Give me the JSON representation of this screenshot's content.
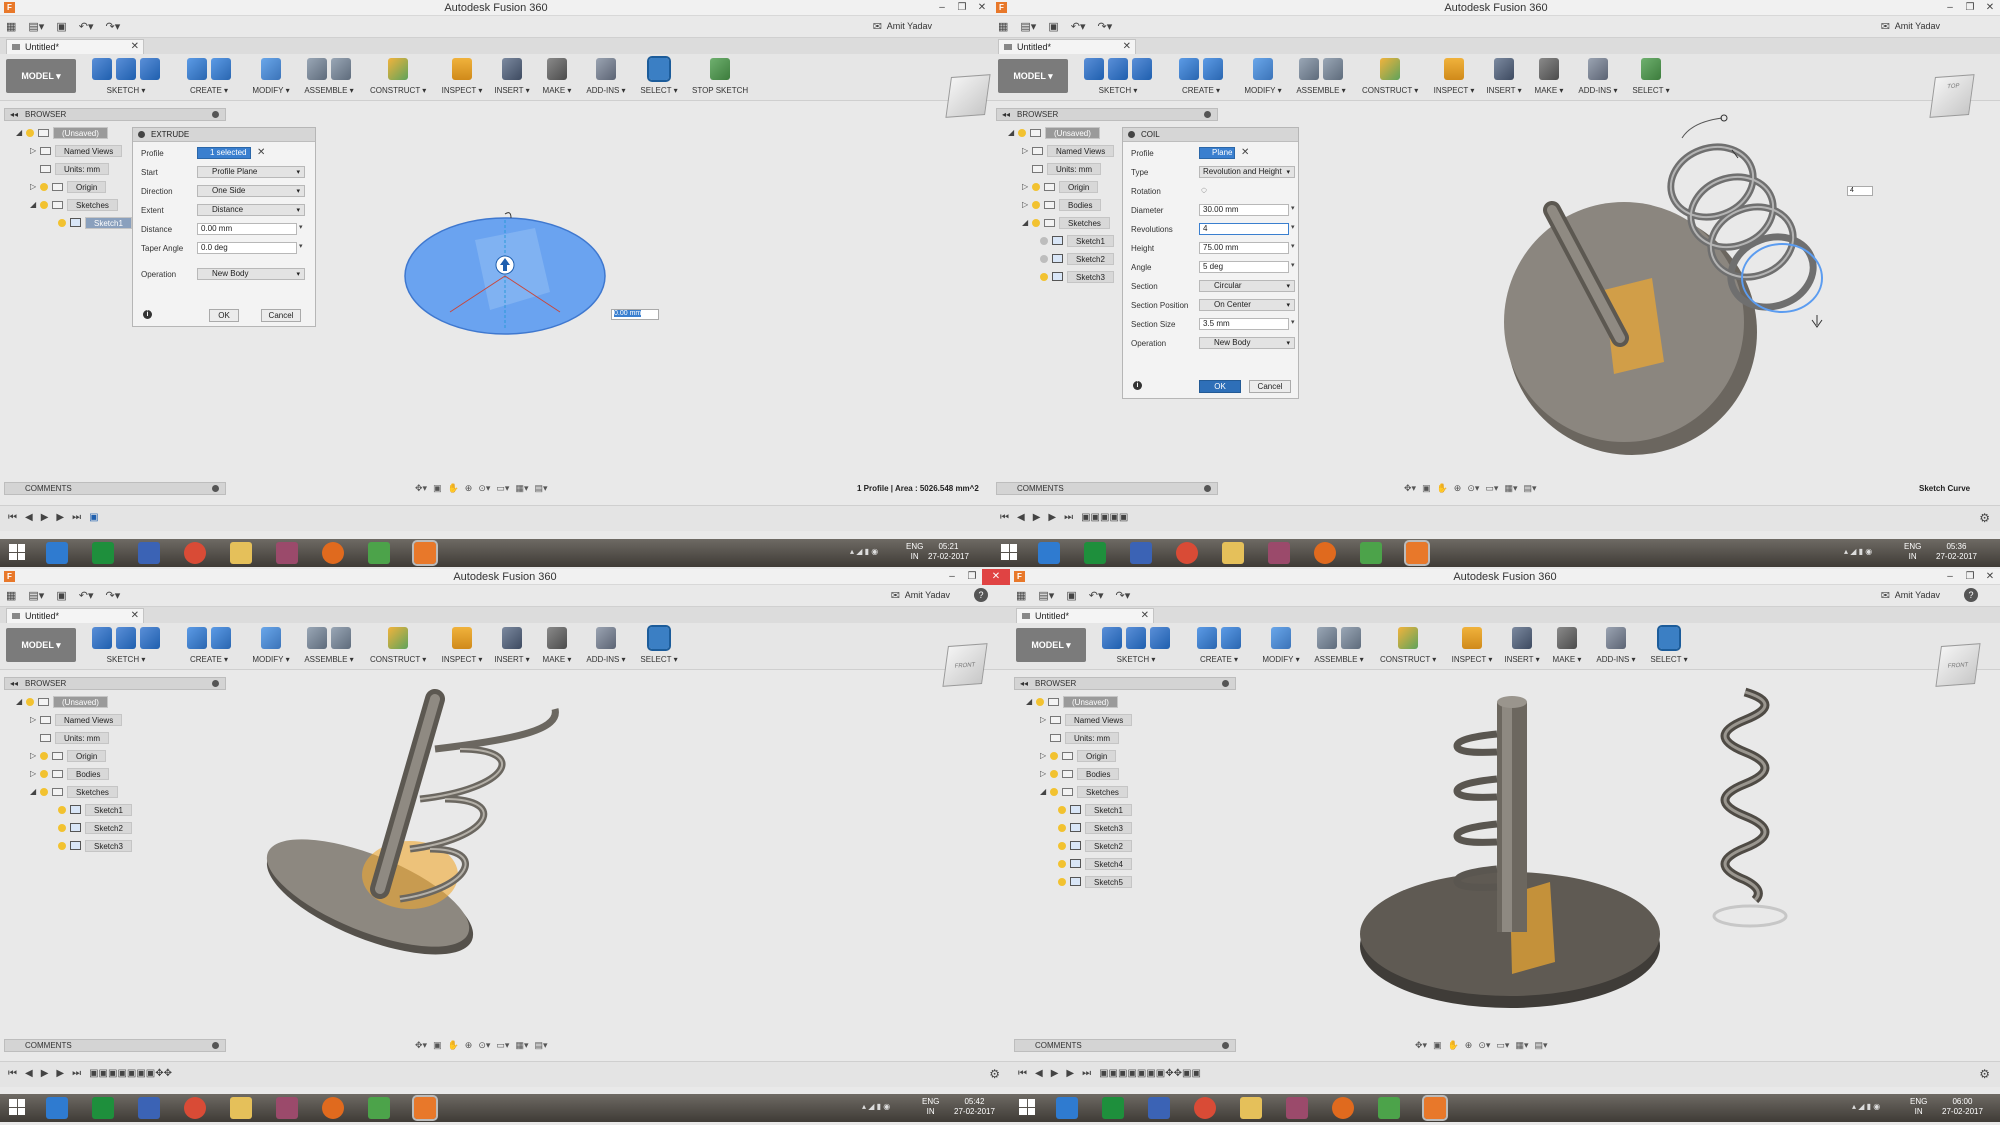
{
  "app": {
    "title": "Autodesk Fusion 360",
    "doc_tab": "Untitled*",
    "user": "Amit Yadav",
    "mode": "MODEL"
  },
  "toolbar": {
    "sketch": "SKETCH ▾",
    "create": "CREATE ▾",
    "modify": "MODIFY ▾",
    "assemble": "ASSEMBLE ▾",
    "construct": "CONSTRUCT ▾",
    "inspect": "INSPECT ▾",
    "insert": "INSERT ▾",
    "make": "MAKE ▾",
    "addins": "ADD-INS ▾",
    "select": "SELECT ▾",
    "stop_sketch": "STOP SKETCH"
  },
  "browser": {
    "header": "BROWSER",
    "root": "(Unsaved)",
    "named_views": "Named Views",
    "units": "Units: mm",
    "origin": "Origin",
    "bodies": "Bodies",
    "sketches": "Sketches",
    "sketch1": "Sketch1",
    "sketch2": "Sketch2",
    "sketch3": "Sketch3",
    "sketch4": "Sketch4",
    "sketch5": "Sketch5"
  },
  "extrude": {
    "title": "EXTRUDE",
    "profile_label": "Profile",
    "profile_value": "1 selected",
    "start_label": "Start",
    "start_value": "Profile Plane",
    "direction_label": "Direction",
    "direction_value": "One Side",
    "extent_label": "Extent",
    "extent_value": "Distance",
    "distance_label": "Distance",
    "distance_value": "0.00 mm",
    "taper_label": "Taper Angle",
    "taper_value": "0.0 deg",
    "operation_label": "Operation",
    "operation_value": "New Body",
    "ok": "OK",
    "cancel": "Cancel",
    "inline_value": "0.00 mm"
  },
  "coil": {
    "title": "COIL",
    "profile_label": "Profile",
    "profile_value": "Plane",
    "type_label": "Type",
    "type_value": "Revolution and Height",
    "rotation_label": "Rotation",
    "diameter_label": "Diameter",
    "diameter_value": "30.00 mm",
    "revolutions_label": "Revolutions",
    "revolutions_value": "4",
    "height_label": "Height",
    "height_value": "75.00 mm",
    "angle_label": "Angle",
    "angle_value": "5 deg",
    "section_label": "Section",
    "section_value": "Circular",
    "section_position_label": "Section Position",
    "section_position_value": "On Center",
    "section_size_label": "Section Size",
    "section_size_value": "3.5 mm",
    "operation_label": "Operation",
    "operation_value": "New Body",
    "ok": "OK",
    "cancel": "Cancel",
    "inline_value": "4"
  },
  "comments": "COMMENTS",
  "status": {
    "q1": "1 Profile | Area : 5026.548 mm^2",
    "q2": "Sketch Curve"
  },
  "viewcube": {
    "top": "TOP",
    "front": "FRONT"
  },
  "taskbar": {
    "lang": "ENG",
    "region": "IN",
    "q1_time": "05:21",
    "q2_time": "05:36",
    "q3_time": "05:42",
    "q4_time": "06:00",
    "date": "27-02-2017"
  },
  "colors": {
    "accent": "#3a7fcf",
    "disc": "#5f5a52",
    "selected_blue": "#5b9cf0",
    "plane_orange": "#f0a830",
    "taskbar_close": "#e04343"
  }
}
